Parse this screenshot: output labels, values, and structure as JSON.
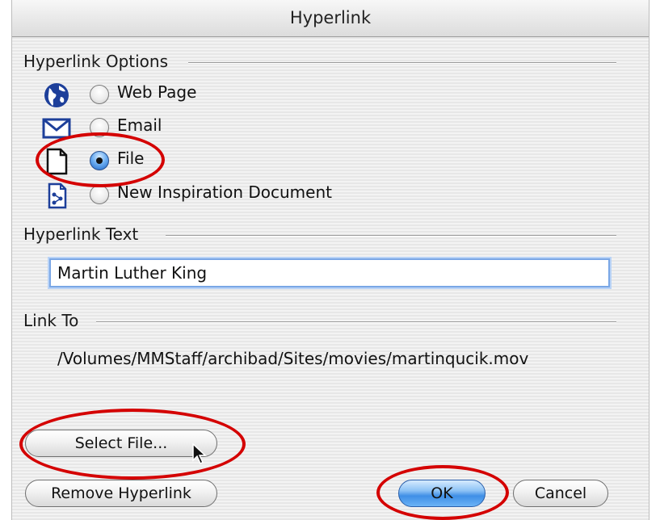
{
  "window": {
    "title": "Hyperlink"
  },
  "options": {
    "heading": "Hyperlink Options",
    "items": [
      {
        "label": "Web Page",
        "icon": "globe-icon",
        "selected": false
      },
      {
        "label": "Email",
        "icon": "envelope-icon",
        "selected": false
      },
      {
        "label": "File",
        "icon": "document-icon",
        "selected": true
      },
      {
        "label": "New Inspiration Document",
        "icon": "inspiration-document-icon",
        "selected": false
      }
    ]
  },
  "hyperlink_text": {
    "heading": "Hyperlink Text",
    "value": "Martin Luther King"
  },
  "link_to": {
    "heading": "Link To",
    "path": "/Volumes/MMStaff/archibad/Sites/movies/martinqucik.mov"
  },
  "buttons": {
    "select_file": "Select File...",
    "remove_hyperlink": "Remove Hyperlink",
    "ok": "OK",
    "cancel": "Cancel"
  },
  "colors": {
    "annotation": "#d40000",
    "icon_blue": "#1d3f9a",
    "default_button": "#3f8fe6"
  }
}
